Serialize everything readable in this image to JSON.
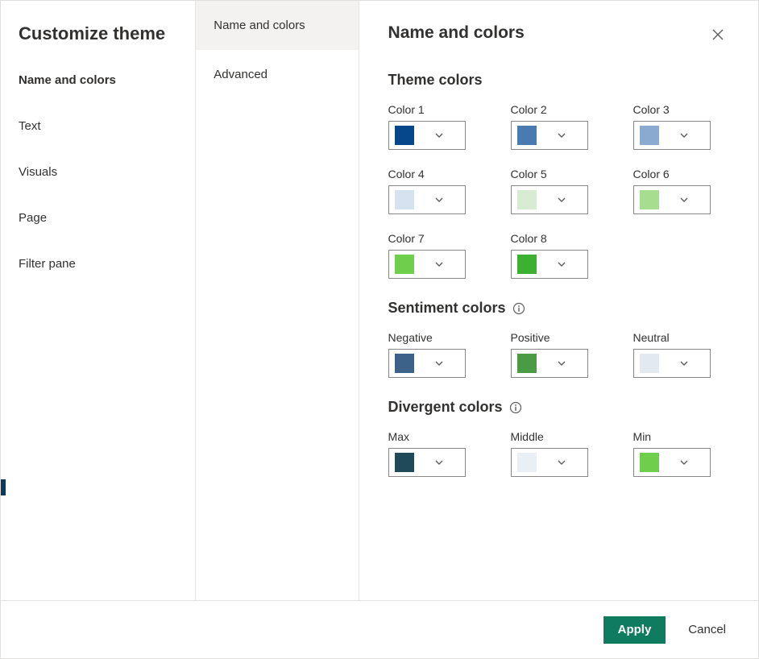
{
  "dialog": {
    "title": "Customize theme",
    "categories": [
      {
        "key": "name_colors",
        "label": "Name and colors"
      },
      {
        "key": "text",
        "label": "Text"
      },
      {
        "key": "visuals",
        "label": "Visuals"
      },
      {
        "key": "page",
        "label": "Page"
      },
      {
        "key": "filter_pane",
        "label": "Filter pane"
      }
    ],
    "active_category": "name_colors",
    "subcategories": [
      {
        "key": "name_colors",
        "label": "Name and colors"
      },
      {
        "key": "advanced",
        "label": "Advanced"
      }
    ],
    "active_subcategory": "name_colors"
  },
  "panel": {
    "title": "Name and colors",
    "sections": {
      "theme_colors": {
        "title": "Theme colors",
        "swatches": [
          {
            "label": "Color 1",
            "color": "#05478a"
          },
          {
            "label": "Color 2",
            "color": "#4a7bb0"
          },
          {
            "label": "Color 3",
            "color": "#8aaacf"
          },
          {
            "label": "Color 4",
            "color": "#d6e2ef"
          },
          {
            "label": "Color 5",
            "color": "#d8ecd3"
          },
          {
            "label": "Color 6",
            "color": "#a6dd8e"
          },
          {
            "label": "Color 7",
            "color": "#6fce4c"
          },
          {
            "label": "Color 8",
            "color": "#3cb030"
          }
        ]
      },
      "sentiment_colors": {
        "title": "Sentiment colors",
        "swatches": [
          {
            "label": "Negative",
            "color": "#3d6289"
          },
          {
            "label": "Positive",
            "color": "#4b9b46"
          },
          {
            "label": "Neutral",
            "color": "#e2e9ef"
          }
        ]
      },
      "divergent_colors": {
        "title": "Divergent colors",
        "swatches": [
          {
            "label": "Max",
            "color": "#204959"
          },
          {
            "label": "Middle",
            "color": "#e9eff4"
          },
          {
            "label": "Min",
            "color": "#6fce4c"
          }
        ]
      }
    }
  },
  "footer": {
    "apply_label": "Apply",
    "cancel_label": "Cancel"
  }
}
